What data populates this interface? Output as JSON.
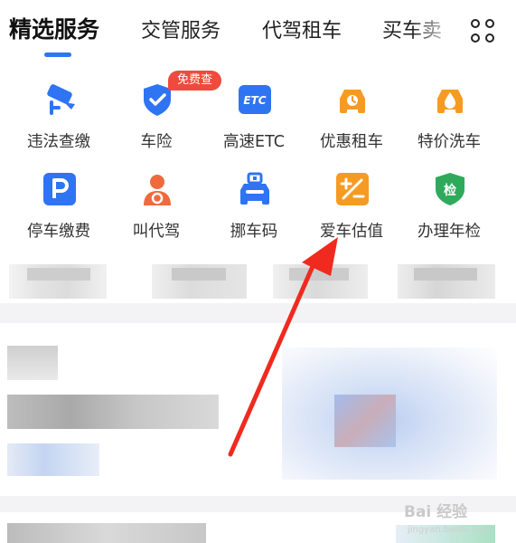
{
  "tabs": [
    {
      "label": "精选服务",
      "active": true
    },
    {
      "label": "交管服务",
      "active": false
    },
    {
      "label": "代驾租车",
      "active": false
    },
    {
      "label": "买车卖",
      "active": false
    }
  ],
  "menu_icon": "grid-menu-icon",
  "services": [
    {
      "label": "违法查缴",
      "icon": "camera-icon",
      "color": "#2f74f2"
    },
    {
      "label": "车险",
      "icon": "shield-check-icon",
      "color": "#2f74f2",
      "badge": "免费查"
    },
    {
      "label": "高速ETC",
      "icon": "etc-icon",
      "color": "#2f74f2"
    },
    {
      "label": "优惠租车",
      "icon": "car-key-icon",
      "color": "#f59b23"
    },
    {
      "label": "特价洗车",
      "icon": "car-wash-icon",
      "color": "#f59b23"
    },
    {
      "label": "停车缴费",
      "icon": "parking-icon",
      "color": "#2f74f2"
    },
    {
      "label": "叫代驾",
      "icon": "driver-icon",
      "color": "#ef6a3c"
    },
    {
      "label": "挪车码",
      "icon": "qr-car-icon",
      "color": "#2f74f2"
    },
    {
      "label": "爱车估值",
      "icon": "calculator-icon",
      "color": "#f59b23"
    },
    {
      "label": "办理年检",
      "icon": "inspection-shield-icon",
      "color": "#2faa5c",
      "icon_text": "检"
    }
  ],
  "colors": {
    "accent": "#2f74f2",
    "badge": "#ee4b3c",
    "arrow": "#f02a1e"
  },
  "watermark": {
    "text": "Bai 经验",
    "sub": "jingyan.baidu.com"
  }
}
